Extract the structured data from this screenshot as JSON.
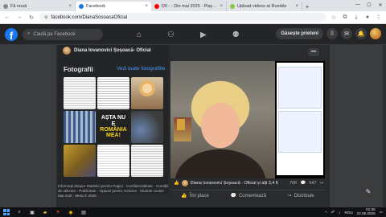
{
  "browser": {
    "tabs": [
      {
        "title": "Fă nouă",
        "active": false,
        "favicon_color": "#888888"
      },
      {
        "title": "Facebook",
        "active": true,
        "favicon_color": "#1877f2"
      },
      {
        "title": "DII - - Din mai 2025 - Playlist",
        "active": false,
        "favicon_color": "#ff0000"
      },
      {
        "title": "Upload videos at Rumble",
        "active": false,
        "favicon_color": "#85c742"
      }
    ],
    "url": "facebook.com/DianaSosoacaOficial"
  },
  "facebook": {
    "logo": "f",
    "search_placeholder": "Caută pe Facebook",
    "find_friends": "Găsește prieteni"
  },
  "post": {
    "author": "Diana Iovanovici Șoșoacă- Oficial"
  },
  "photos": {
    "title": "Fotografii",
    "see_all": "Vezi toate fotografiile",
    "tile_text_line1": "AȘTA NU E",
    "tile_text_line2": "ROMÂNIA MEA!"
  },
  "footer": {
    "text": "Informații despre Statistici pentru Pagini · Confidențialitate · Condiții de utilizare · Publicitate · Opțiuni pentru reclame · Module cookie · Mai mult · Meta © 2025"
  },
  "video": {
    "author_line": "Diana Iovanovici Șoșoacă - Oficial și alți 3,4 K",
    "likes": "76K",
    "comments": "647"
  },
  "actions": {
    "like": "Îmi place",
    "comment": "Comentează",
    "share": "Distribuie"
  },
  "taskbar": {
    "lang": "ROU",
    "time": "01:35",
    "date": "22.05.2025"
  },
  "colors": {
    "fb_blue": "#1877f2",
    "fb_dark": "#242526",
    "link_blue": "#4599ff"
  }
}
